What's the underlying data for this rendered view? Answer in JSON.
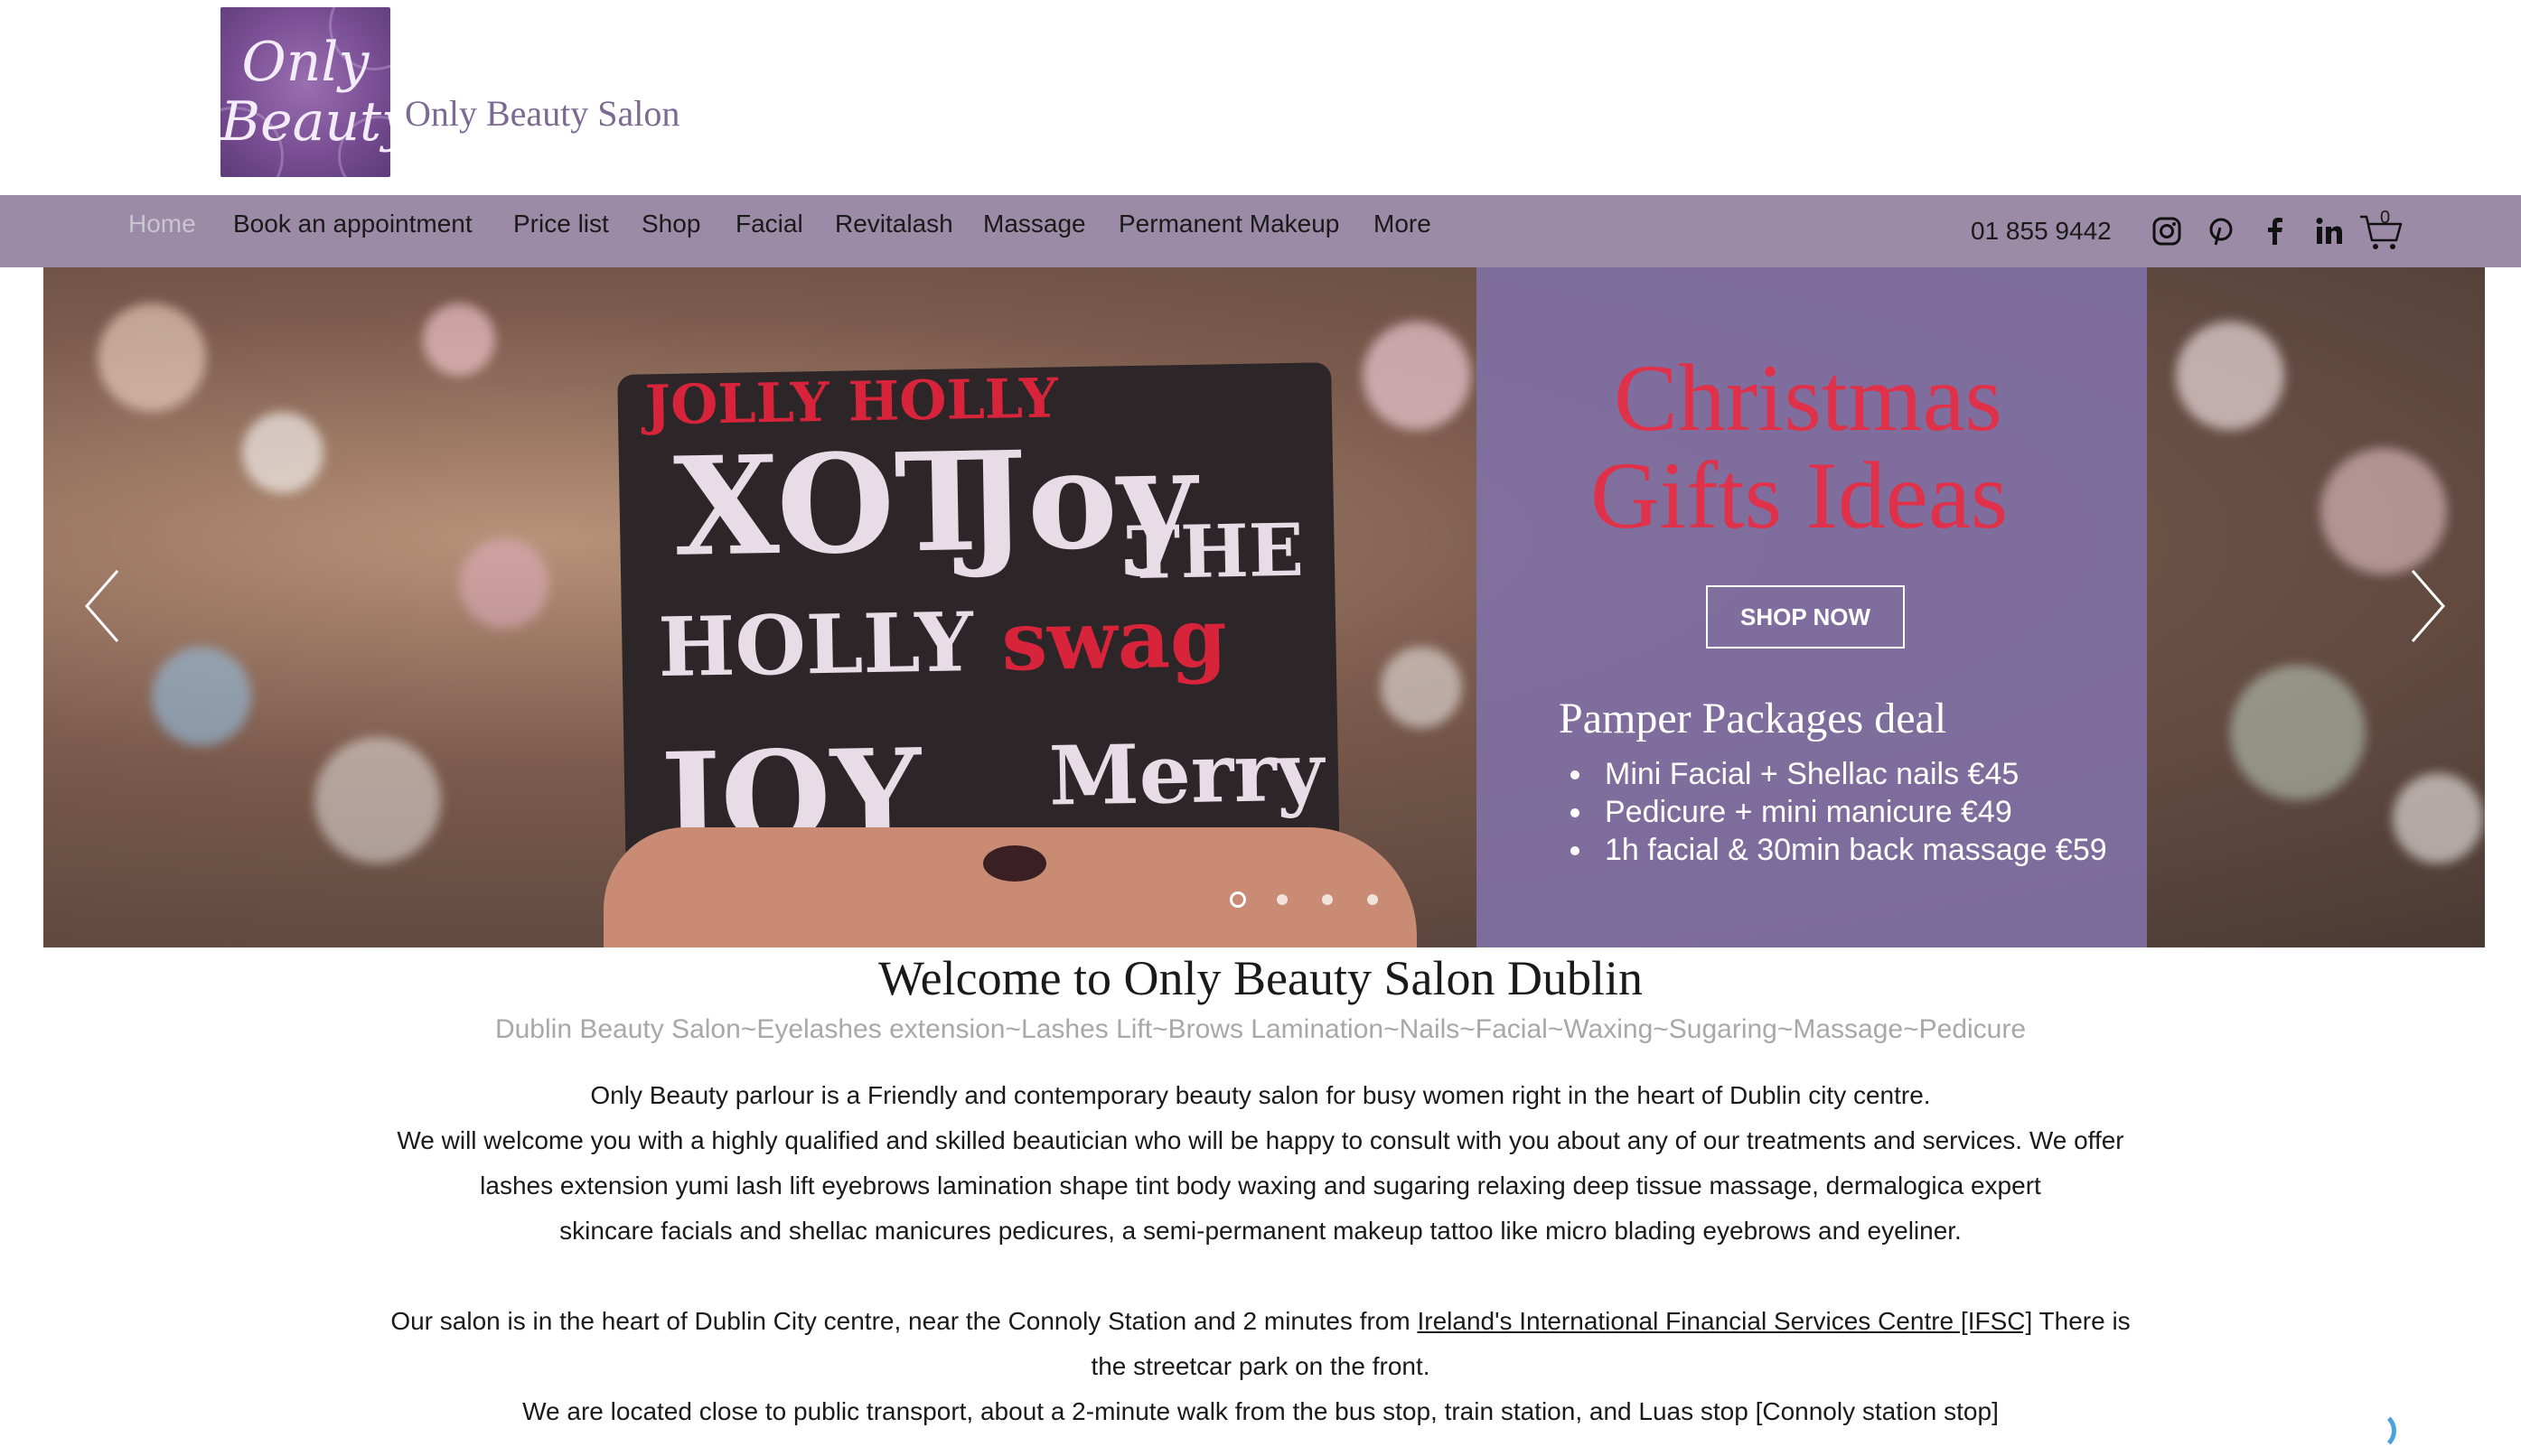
{
  "header": {
    "logo_line1": "Only",
    "logo_line2": "Beauty",
    "site_title": "Only Beauty Salon"
  },
  "nav": {
    "items": [
      {
        "label": "Home",
        "active": true
      },
      {
        "label": "Book an appointment",
        "active": false
      },
      {
        "label": "Price list",
        "active": false
      },
      {
        "label": "Shop",
        "active": false
      },
      {
        "label": "Facial",
        "active": false
      },
      {
        "label": "Revitalash",
        "active": false
      },
      {
        "label": "Massage",
        "active": false
      },
      {
        "label": "Permanent Makeup",
        "active": false
      },
      {
        "label": "More",
        "active": false
      }
    ],
    "phone": "01 855 9442",
    "social_icons": [
      "instagram-icon",
      "pinterest-icon",
      "facebook-icon",
      "linkedin-icon"
    ],
    "cart_count": "0"
  },
  "hero": {
    "promo_line1": "Christmas",
    "promo_line2": "Gifts Ideas",
    "shop_button": "SHOP NOW",
    "pamper_title": "Pamper Packages deal",
    "pamper_items": [
      "Mini Facial + Shellac nails €45",
      "Pedicure + mini manicure €49",
      "1h facial & 30min back massage €59"
    ],
    "slide_count": 4,
    "active_slide": 1,
    "colors": {
      "promo_red": "#e0314a",
      "panel_purple": "#8171a6",
      "nav_bg": "#9c8ba6"
    }
  },
  "content": {
    "welcome_title": "Welcome to Only Beauty Salon Dublin",
    "tagline": "Dublin Beauty Salon~Eyelashes extension~Lashes Lift~Brows Lamination~Nails~Facial~Waxing~Sugaring~Massage~Pedicure",
    "para1_line1": "Only Beauty parlour is a Friendly and contemporary beauty salon for busy women right in the heart of Dublin city centre.",
    "para1_line2": "We will welcome you with a highly qualified and skilled beautician who will be happy to consult with you about any of our treatments and services. We offer",
    "para1_line3": "lashes extension yumi lash lift eyebrows lamination shape tint body waxing and sugaring relaxing deep tissue massage, dermalogica expert",
    "para1_line4": "skincare facials and shellac manicures pedicures, a semi-permanent makeup tattoo like micro blading eyebrows and eyeliner.",
    "para2_before": "Our salon is in the heart of Dublin City centre, near the Connoly Station and 2 minutes from ",
    "para2_link": "Ireland's International Financial Services Centre [IFSC]",
    "para2_after": " There is",
    "para2_line2": "the streetcar park on the front.",
    "para3": "We are located close to public transport, about a 2-minute walk from the bus stop, train station, and Luas stop [Connoly station stop]"
  }
}
